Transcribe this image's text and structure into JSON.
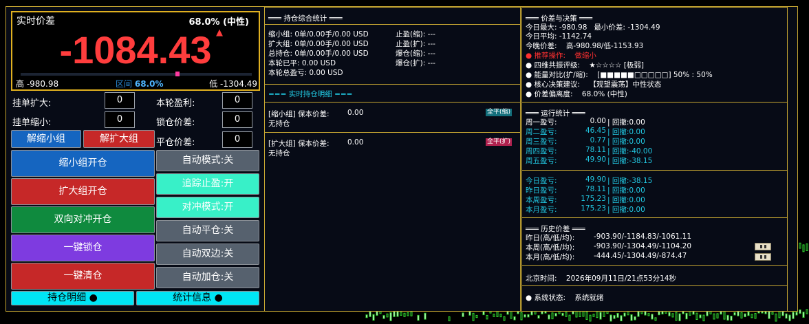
{
  "window_title": "",
  "price_panel": {
    "label": "实时价差",
    "deviation": "68.0% (中性)",
    "big_value": "-1084.43",
    "high_text": "高 -980.98",
    "range_label": "区间",
    "range_pct": "68.0%",
    "low_text": "低 -1304.49",
    "range_fraction": 0.68
  },
  "fields": {
    "pending_expand_label": "挂单扩大:",
    "pending_expand_value": "0",
    "pending_shrink_label": "挂单缩小:",
    "pending_shrink_value": "0",
    "round_profit_label": "本轮盈利:",
    "round_profit_value": "0",
    "lock_spread_label": "锁仓价差:",
    "lock_spread_value": "0",
    "close_spread_label": "平仓价差:",
    "close_spread_value": "0"
  },
  "buttons": {
    "unlock_shrink": "解缩小组",
    "unlock_expand": "解扩大组",
    "shrink_open": "缩小组开仓",
    "expand_open": "扩大组开仓",
    "hedge_open": "双向对冲开仓",
    "lock_all": "一键锁仓",
    "clear_all": "一键清仓",
    "auto_mode": "自动模式:关",
    "trailing_stop": "追踪止盈:开",
    "hedge_mode": "对冲模式:开",
    "auto_close": "自动平仓:关",
    "auto_both": "自动双边:关",
    "auto_add": "自动加仓:关",
    "positions_detail": "持仓明细 ●",
    "stats_info": "统计信息 ●"
  },
  "positions_panel": {
    "title": "═══ 持仓综合统计 ═══",
    "left_lines": [
      "缩小组: 0单/0.00手/0.00 USD",
      "扩大组: 0单/0.00手/0.00 USD",
      "总持仓: 0单/0.00手/0.00 USD",
      "本轮已平: 0.00 USD",
      "本轮总盈亏: 0.00 USD"
    ],
    "right_lines": [
      "止盈(缩): ---",
      "止盈(扩): ---",
      "爆仓(缩): ---",
      "爆仓(扩): ---"
    ],
    "detail_title": "=== 实时持仓明细 ===",
    "shrink_header": "[缩小组] 保本价差:",
    "shrink_breakeven": "0.00",
    "shrink_close_all": "全平(缩)",
    "shrink_status": "无持仓",
    "expand_header": "[扩大组] 保本价差:",
    "expand_breakeven": "0.00",
    "expand_close_all": "全平(扩)",
    "expand_status": "无持仓"
  },
  "decision_panel": {
    "title": "═══ 价差与决策 ═══",
    "today_max_label": "今日最大:",
    "today_max": "-980.98",
    "min_label": "最小价差:",
    "min_value": "-1304.49",
    "today_avg_label": "今日平均:",
    "today_avg": "-1142.74",
    "tonight_label": "今晚价差:",
    "tonight_value": "高-980.98/低-1153.93",
    "recommend_label": "● 推荐操作:",
    "recommend_value": "做缩小",
    "resonance_label": "● 四维共振评级:",
    "resonance_stars": "★☆☆☆☆ [极弱]",
    "energy_label": "● 能量对比(扩/缩):",
    "energy_bar": "[■■■■■□□□□□] 50% : 50%",
    "core_label": "● 核心决策建议:",
    "core_value": "【观望震荡】中性状态",
    "deviation_label": "● 价差偏离度:",
    "deviation_value": "68.0% (中性)",
    "running_title": "═══ 运行统计 ═══",
    "weekdays": [
      {
        "label": "周一盈亏:",
        "pnl": "0.00",
        "drawdown": "| 回撤:0.00"
      },
      {
        "label": "周二盈亏:",
        "pnl": "46.45",
        "drawdown": "| 回撤:0.00"
      },
      {
        "label": "周三盈亏:",
        "pnl": "0.77",
        "drawdown": "| 回撤:0.00"
      },
      {
        "label": "周四盈亏:",
        "pnl": "78.11",
        "drawdown": "| 回撤:-40.00"
      },
      {
        "label": "周五盈亏:",
        "pnl": "49.90",
        "drawdown": "| 回撤:-38.15"
      }
    ],
    "periods": [
      {
        "label": "今日盈亏:",
        "pnl": "49.90",
        "drawdown": "| 回撤:-38.15"
      },
      {
        "label": "昨日盈亏:",
        "pnl": "78.11",
        "drawdown": "| 回撤:0.00"
      },
      {
        "label": "本周盈亏:",
        "pnl": "175.23",
        "drawdown": "| 回撤:0.00"
      },
      {
        "label": "本月盈亏:",
        "pnl": "175.23",
        "drawdown": "| 回撤:0.00"
      }
    ],
    "history_title": "═══ 历史价差 ═══",
    "history": [
      {
        "label": "昨日(高/低/均):",
        "value": "-903.90/-1184.83/-1061.11"
      },
      {
        "label": "本周(高/低/均):",
        "value": "-903.90/-1304.49/-1104.20"
      },
      {
        "label": "本月(高/低/均):",
        "value": "-444.45/-1304.49/-874.47"
      }
    ],
    "beijing_label": "北京时间:",
    "beijing_time": "2026年09月11日/21点53分14秒",
    "system_label": "● 系统状态:",
    "system_value": "系统就绪"
  },
  "colors": {
    "accent_border": "#c8a832",
    "price_red": "#ff3d3d",
    "stat_cyan": "#22c9e3"
  }
}
